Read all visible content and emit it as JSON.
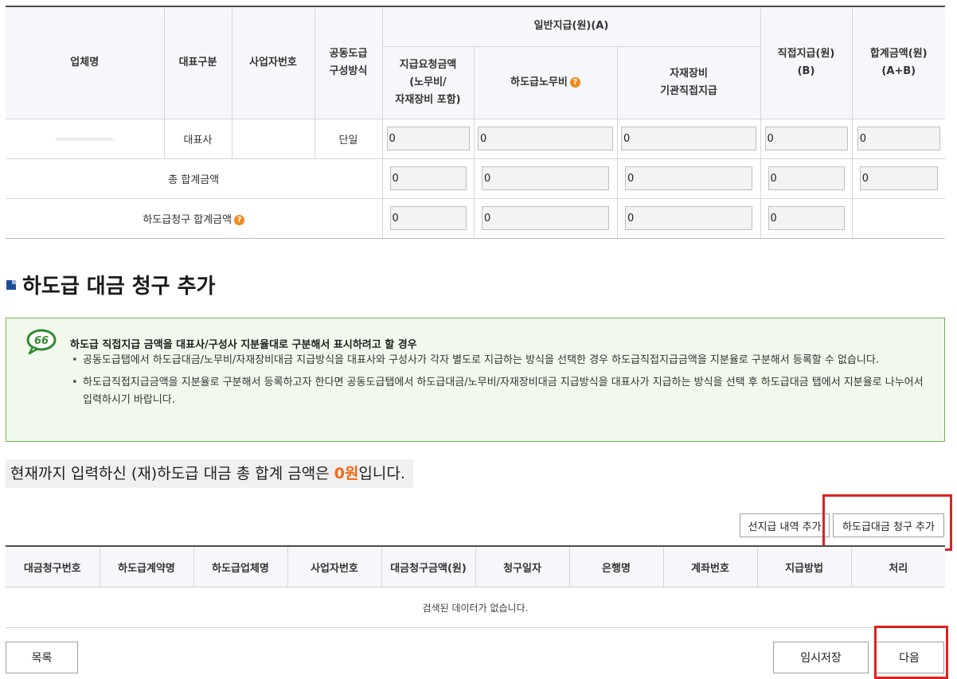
{
  "payment_table": {
    "headers": {
      "company": "업체명",
      "rep_type": "대표구분",
      "biz_no": "사업자번호",
      "joint_method_l1": "공동도급",
      "joint_method_l2": "구성방식",
      "general_payment": "일반지급(원)(A)",
      "claim_amount_l1": "지급요청금액",
      "claim_amount_l2": "(노무비/",
      "claim_amount_l3": "자재장비 포함)",
      "sub_labor": "하도급노무비",
      "material_l1": "자재장비",
      "material_l2": "기관직접지급",
      "direct_l1": "직접지급(원)",
      "direct_l2": "(B)",
      "total_l1": "합계금액(원)",
      "total_l2": "(A+B)"
    },
    "row": {
      "rep_type": "대표사",
      "joint_method": "단일",
      "claim_amount": "0",
      "sub_labor": "0",
      "material": "0",
      "direct": "0",
      "total": "0"
    },
    "grand_total": {
      "label": "총 합계금액",
      "claim_amount": "0",
      "sub_labor": "0",
      "material": "0",
      "direct": "0",
      "total": "0"
    },
    "subcontract_total": {
      "label": "하도급청구 합계금액",
      "claim_amount": "0",
      "sub_labor": "0",
      "material": "0",
      "direct": "0"
    },
    "help_glyph": "?"
  },
  "section": {
    "title": "하도급 대금 청구 추가"
  },
  "notice": {
    "title": "하도급 직접지급 금액을 대표사/구성사 지분율대로 구분해서 표시하려고 할 경우",
    "items": [
      "공동도급탭에서 하도급대금/노무비/자재장비대금 지급방식을 대표사와 구성사가 각자 별도로 지급하는 방식을 선택한 경우 하도급직접지급금액을 지분율로 구분해서 등록할 수 없습니다.",
      "하도급직접지급금액을 지분율로 구분해서 등록하고자 한다면 공동도급탭에서 하도급대금/노무비/자재장비대금 지급방식을 대표사가 지급하는 방식을 선택 후 하도급대금 탭에서 지분율로 나누어서 입력하시기 바랍니다."
    ],
    "icon": "speech-bubble-icon",
    "icon_glyph": "66"
  },
  "summary": {
    "prefix": "현재까지 입력하신 (재)하도급 대금 총 합계 금액은 ",
    "amount": "0원",
    "suffix": "입니다."
  },
  "buttons": {
    "prepay": "선지급 내역 추가",
    "add_claim": "하도급대금 청구 추가",
    "list": "목록",
    "temp_save": "임시저장",
    "next": "다음"
  },
  "claims_table": {
    "columns": [
      "대금청구번호",
      "하도급계약명",
      "하도급업체명",
      "사업자번호",
      "대금청구금액(원)",
      "청구일자",
      "은행명",
      "계좌번호",
      "지급방법",
      "처리"
    ],
    "empty_message": "검색된 데이터가 없습니다."
  },
  "colors": {
    "accent_orange": "#ee6a12",
    "highlight_red": "#e02020",
    "notice_green": "#6fb455",
    "notice_bg": "#f1f9ec",
    "section_icon": "#1f4e96"
  }
}
